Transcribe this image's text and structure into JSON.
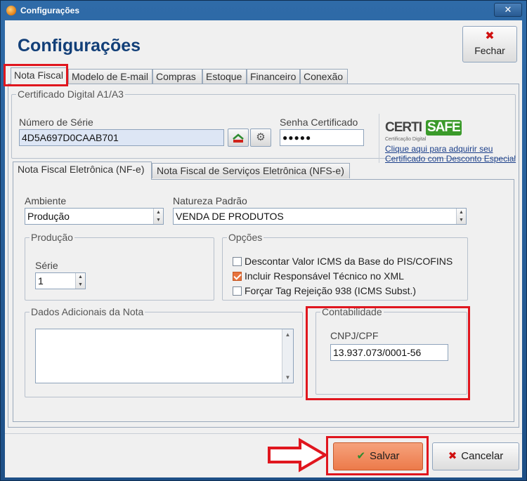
{
  "window": {
    "title": "Configurações"
  },
  "header": {
    "title": "Configurações",
    "close_label": "Fechar"
  },
  "tabs": [
    {
      "label": "Nota Fiscal"
    },
    {
      "label": "Modelo de E-mail"
    },
    {
      "label": "Compras"
    },
    {
      "label": "Estoque"
    },
    {
      "label": "Financeiro"
    },
    {
      "label": "Conexão"
    }
  ],
  "certificado": {
    "group_title": "Certificado Digital A1/A3",
    "serial_label": "Número de Série",
    "serial_value": "4D5A697D0CAAB701",
    "password_label": "Senha Certificado",
    "password_value": "●●●●●",
    "logo_text_a": "CERTI",
    "logo_text_b": "SAFE",
    "logo_sub": "Certificação Digital",
    "link_text": "Clique aqui para adquirir seu Certificado com Desconto Especial"
  },
  "subtabs": [
    {
      "label": "Nota Fiscal Eletrônica (NF-e)"
    },
    {
      "label": "Nota Fiscal de Serviços Eletrônica (NFS-e)"
    }
  ],
  "nfe": {
    "ambiente_label": "Ambiente",
    "ambiente_value": "Produção",
    "natureza_label": "Natureza Padrão",
    "natureza_value": "VENDA DE PRODUTOS",
    "producao_group": "Produção",
    "serie_label": "Série",
    "serie_value": "1",
    "opcoes_group": "Opções",
    "opcoes": [
      {
        "label": "Descontar Valor ICMS da Base do PIS/COFINS",
        "checked": false
      },
      {
        "label": "Incluir Responsável Técnico no XML",
        "checked": true
      },
      {
        "label": "Forçar Tag Rejeição 938 (ICMS Subst.)",
        "checked": false
      }
    ],
    "dados_group": "Dados Adicionais da Nota",
    "dados_value": "",
    "contabilidade_group": "Contabilidade",
    "cnpj_label": "CNPJ/CPF",
    "cnpj_value": "13.937.073/0001-56"
  },
  "footer": {
    "save_label": "Salvar",
    "cancel_label": "Cancelar"
  },
  "colors": {
    "highlight": "#e0161e",
    "save_button": "#ec7a4a",
    "title": "#123f78"
  }
}
